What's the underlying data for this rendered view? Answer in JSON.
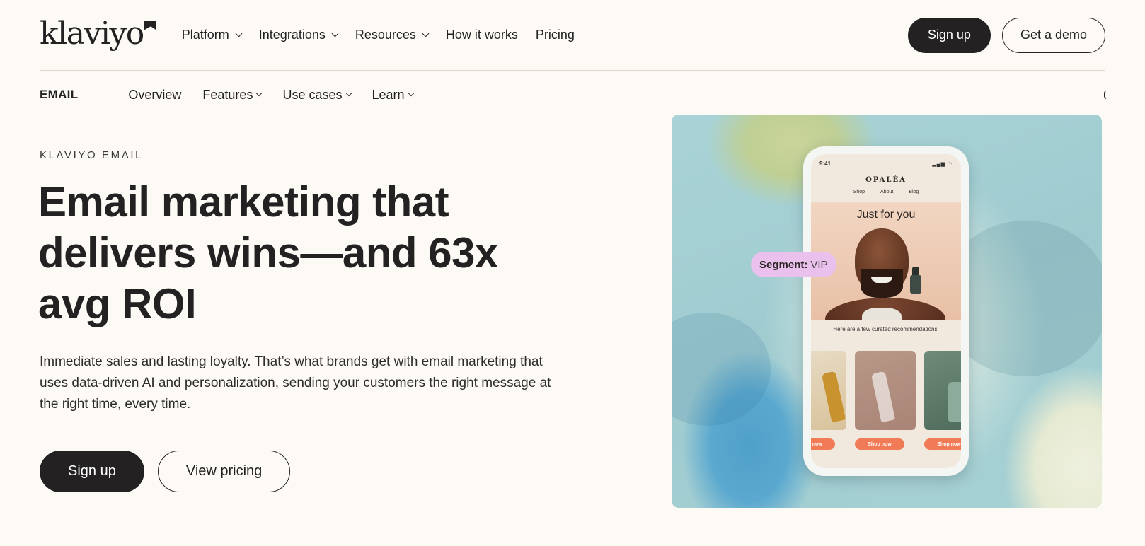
{
  "brand": {
    "logo_text": "klaviyo"
  },
  "topnav": {
    "items": [
      {
        "label": "Platform",
        "dropdown": true
      },
      {
        "label": "Integrations",
        "dropdown": true
      },
      {
        "label": "Resources",
        "dropdown": true
      },
      {
        "label": "How it works",
        "dropdown": false
      },
      {
        "label": "Pricing",
        "dropdown": false
      }
    ],
    "signup_label": "Sign up",
    "demo_label": "Get a demo"
  },
  "subnav": {
    "brand": "EMAIL",
    "items": [
      {
        "label": "Overview",
        "dropdown": false
      },
      {
        "label": "Features",
        "dropdown": true
      },
      {
        "label": "Use cases",
        "dropdown": true
      },
      {
        "label": "Learn",
        "dropdown": true
      }
    ]
  },
  "hero": {
    "eyebrow": "KLAVIYO EMAIL",
    "headline": "Email marketing that delivers wins—and 63x avg ROI",
    "body": "Immediate sales and lasting loyalty. That’s what brands get with email marketing that uses data-driven AI and personalization, sending your customers the right message at the right time, every time.",
    "primary_cta": "Sign up",
    "secondary_cta": "View pricing"
  },
  "phone_mock": {
    "status_time": "9:41",
    "store_name": "OPALÉA",
    "store_nav": [
      "Shop",
      "About",
      "Blog"
    ],
    "card_title": "Just for you",
    "reco_text": "Here are a few curated recommendations.",
    "shop_labels": [
      "Shop now",
      "Shop now",
      "Shop now"
    ],
    "segment_label": "Segment:",
    "segment_value": "VIP"
  },
  "colors": {
    "background": "#fdfaf6",
    "ink": "#232121",
    "segment_pill": "#e9c1ec",
    "shop_button": "#f07b56"
  }
}
